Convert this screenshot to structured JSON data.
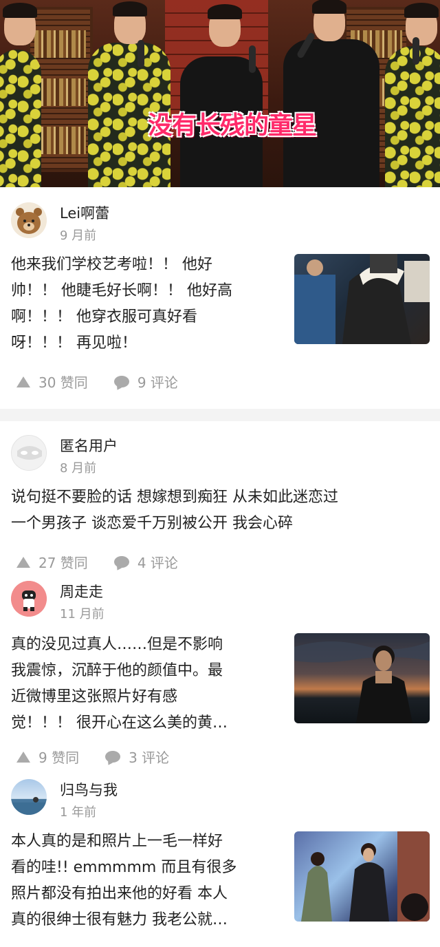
{
  "hero": {
    "caption": "没有长残的童星"
  },
  "posts": [
    {
      "username": "Lei啊蕾",
      "time": "9 月前",
      "lines": [
        "他来我们学校艺考啦！！ 他好",
        "帅！！ 他睫毛好长啊！！ 他好高",
        "啊！！！ 他穿衣服可真好看",
        "呀！！！ 再见啦！"
      ],
      "likes": "30 赞同",
      "comments": "9 评论",
      "has_image": true
    },
    {
      "username": "匿名用户",
      "time": "8 月前",
      "lines": [
        "说句挺不要脸的话 想嫁想到痴狂 从未如此迷恋过",
        "一个男孩子 谈恋爱千万别被公开 我会心碎"
      ],
      "likes": "27 赞同",
      "comments": "4 评论",
      "has_image": false
    },
    {
      "username": "周走走",
      "time": "11 月前",
      "lines": [
        "真的没见过真人……但是不影响",
        "我震惊，沉醉于他的颜值中。最",
        "近微博里这张照片好有感",
        "觉！！！ 很开心在这么美的黄…"
      ],
      "likes": "9 赞同",
      "comments": "3 评论",
      "has_image": true
    },
    {
      "username": "归鸟与我",
      "time": "1 年前",
      "lines": [
        "本人真的是和照片上一毛一样好",
        "看的哇!! emmmmm 而且有很多",
        "照片都没有拍出来他的好看 本人",
        "真的很绅士很有魅力 我老公就…"
      ],
      "has_image": true
    }
  ],
  "icons": {
    "like": "upvote-triangle-icon",
    "comment": "comment-bubble-icon"
  },
  "colors": {
    "meta": "#999999",
    "caption": "#ff2a6a",
    "separator": "#f3f3f3"
  }
}
